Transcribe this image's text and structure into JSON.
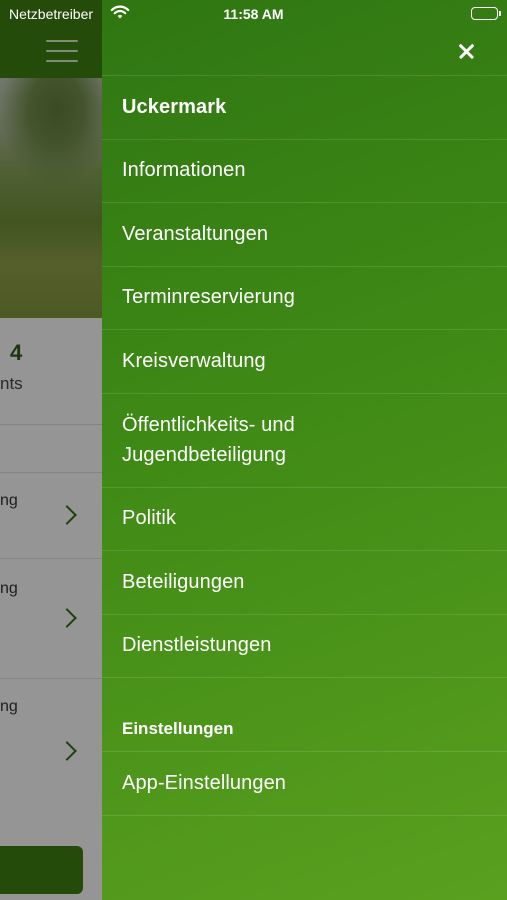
{
  "status_bar": {
    "carrier": "Netzbetreiber",
    "time": "11:58 AM"
  },
  "background": {
    "counter_value": "4",
    "counter_label_fragment": "nts",
    "row_fragments": [
      "ng",
      "ng",
      "ng"
    ]
  },
  "drawer": {
    "items": [
      {
        "label": "Uckermark"
      },
      {
        "label": "Informationen"
      },
      {
        "label": "Veranstaltungen"
      },
      {
        "label": "Terminreservierung"
      },
      {
        "label": "Kreisverwaltung"
      },
      {
        "label": "Öffentlichkeits- und Jugendbeteiligung"
      },
      {
        "label": "Politik"
      },
      {
        "label": "Beteiligungen"
      },
      {
        "label": "Dienstleistungen"
      }
    ],
    "settings_section": {
      "title": "Einstellungen",
      "items": [
        {
          "label": "App-Einstellungen"
        }
      ]
    }
  },
  "icons": {
    "close": "close-icon",
    "menu": "hamburger-menu-icon",
    "wifi": "wifi-icon",
    "battery": "battery-icon"
  },
  "colors": {
    "brand_green": "#3a7a10",
    "drawer_gradient_start": "#2f7612",
    "drawer_gradient_end": "#5aa01f"
  }
}
